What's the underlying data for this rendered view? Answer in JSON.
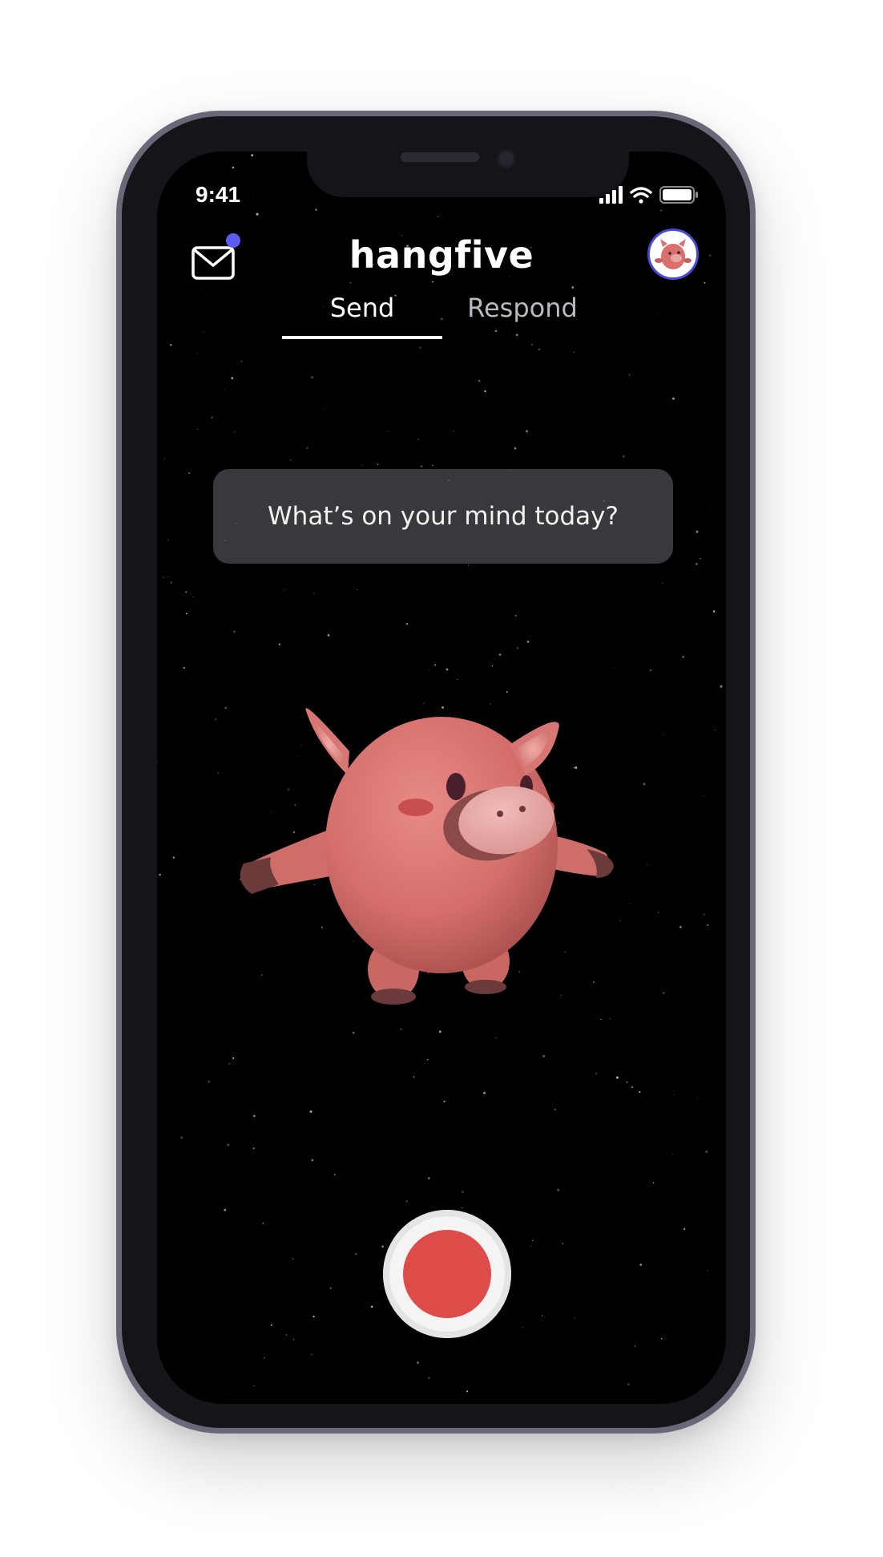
{
  "status_bar": {
    "time": "9:41"
  },
  "header": {
    "title": "hangfive",
    "has_unread": true,
    "accent_color": "#5b5cf0"
  },
  "tabs": [
    {
      "label": "Send",
      "active": true
    },
    {
      "label": "Respond",
      "active": false
    }
  ],
  "prompt": {
    "text": "What’s on your mind today?"
  },
  "record_button": {
    "color": "#de4c4a"
  },
  "icons": [
    "mail-icon",
    "notification-dot",
    "cellular-signal-icon",
    "wifi-icon",
    "battery-icon",
    "profile-avatar-pig",
    "pig-character",
    "record-icon"
  ]
}
